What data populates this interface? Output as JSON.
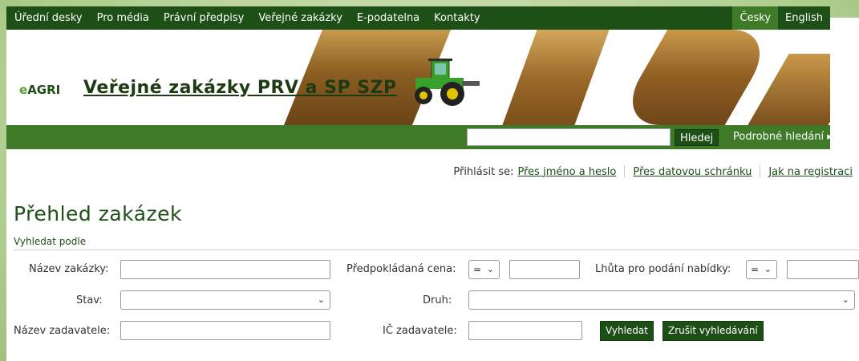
{
  "nav": {
    "items": [
      "Úřední desky",
      "Pro média",
      "Právní předpisy",
      "Veřejné zakázky",
      "E-podatelna",
      "Kontakty"
    ],
    "lang_cs": "Česky",
    "lang_en": "English"
  },
  "header": {
    "logo_e": "e",
    "logo_agri": "AGRI",
    "title": "Veřejné zakázky PRV a SP SZP"
  },
  "search": {
    "value": "",
    "button": "Hledej",
    "advanced": "Podrobné hledání ▸"
  },
  "login": {
    "label": "Přihlásit se:",
    "link_password": "Přes jméno a heslo",
    "link_databox": "Přes datovou schránku",
    "link_howto": "Jak na registraci"
  },
  "main": {
    "title": "Přehled zakázek",
    "search_by": "Vyhledat podle"
  },
  "form": {
    "name_label": "Název zakázky:",
    "name_value": "",
    "price_label": "Předpokládaná cena:",
    "price_op": "=",
    "price_value": "",
    "deadline_label": "Lhůta pro podání nabídky:",
    "deadline_op": "=",
    "deadline_value": "",
    "status_label": "Stav:",
    "status_value": "",
    "type_label": "Druh:",
    "type_value": "",
    "contractor_label": "Název zadavatele:",
    "contractor_value": "",
    "ico_label": "IČ zadavatele:",
    "ico_value": "",
    "search_button": "Vyhledat",
    "cancel_button": "Zrušit vyhledávání"
  },
  "colors": {
    "nav_dark": "#1d4f17",
    "nav_active": "#3e7a28",
    "frame": "#a9c98a"
  }
}
